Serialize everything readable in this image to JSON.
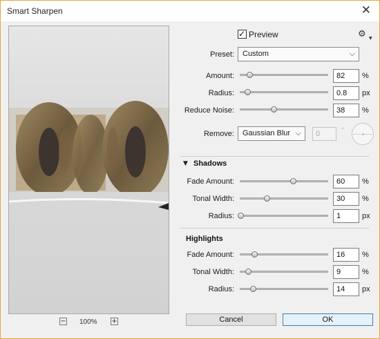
{
  "window": {
    "title": "Smart Sharpen",
    "close_glyph": "✕"
  },
  "zoom": {
    "level": "100%",
    "minus_glyph": "−",
    "plus_glyph": "+"
  },
  "preview": {
    "label": "Preview",
    "checked": true
  },
  "preset": {
    "label": "Preset:",
    "value": "Custom"
  },
  "settings": [
    {
      "label": "Amount:",
      "value": "82",
      "unit": "%",
      "slider": 0.1
    },
    {
      "label": "Radius:",
      "value": "0.8",
      "unit": "px",
      "slider": 0.08
    },
    {
      "label": "Reduce Noise:",
      "value": "38",
      "unit": "%",
      "slider": 0.38
    }
  ],
  "remove": {
    "label": "Remove:",
    "value": "Gaussian Blur",
    "angle": "0",
    "degree_symbol": "°"
  },
  "shadows": {
    "title": "Shadows",
    "rows": [
      {
        "label": "Fade Amount:",
        "value": "60",
        "unit": "%",
        "slider": 0.6
      },
      {
        "label": "Tonal Width:",
        "value": "30",
        "unit": "%",
        "slider": 0.3
      },
      {
        "label": "Radius:",
        "value": "1",
        "unit": "px",
        "slider": 0.0
      }
    ]
  },
  "highlights": {
    "title": "Highlights",
    "rows": [
      {
        "label": "Fade Amount:",
        "value": "16",
        "unit": "%",
        "slider": 0.16
      },
      {
        "label": "Tonal Width:",
        "value": "9",
        "unit": "%",
        "slider": 0.09
      },
      {
        "label": "Radius:",
        "value": "14",
        "unit": "px",
        "slider": 0.14
      }
    ]
  },
  "buttons": {
    "cancel": "Cancel",
    "ok": "OK"
  },
  "icons": {
    "gear": "gear-icon",
    "dropdown": "chevron-down-icon",
    "collapse": "triangle-down-icon"
  },
  "colors": {
    "ok_border": "#3c7fb1",
    "window_border": "#e4a53a"
  }
}
